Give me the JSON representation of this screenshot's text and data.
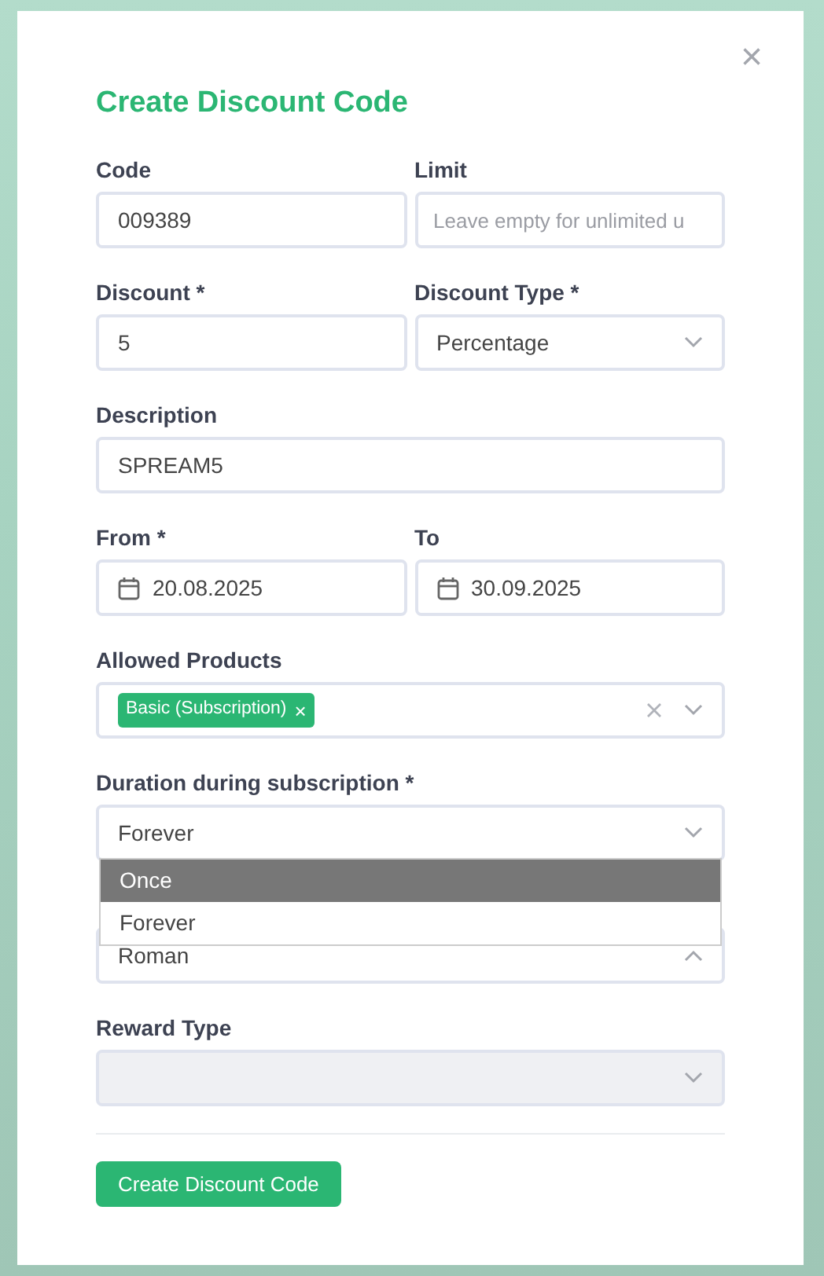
{
  "dialog": {
    "title": "Create Discount Code",
    "close": "×"
  },
  "rows": [
    [
      {
        "kind": "text",
        "label": "Code",
        "value": "009389"
      },
      {
        "kind": "text",
        "label": "Limit",
        "placeholder": "Leave empty for unlimited u"
      }
    ],
    [
      {
        "kind": "text",
        "label": "Discount *",
        "value": "5"
      },
      {
        "kind": "select",
        "label": "Discount Type *",
        "value": "Percentage",
        "expanded": false,
        "disabled": false
      }
    ],
    [
      {
        "kind": "text",
        "label": "Description",
        "value": "SPREAM5"
      }
    ],
    [
      {
        "kind": "date",
        "label": "From *",
        "value": "20.08.2025"
      },
      {
        "kind": "date",
        "label": "To",
        "value": "30.09.2025"
      }
    ],
    [
      {
        "kind": "multi",
        "label": "Allowed Products",
        "tags": [
          {
            "text": "Basic (Subscription)",
            "remove": "×"
          }
        ]
      }
    ],
    [
      {
        "kind": "select",
        "label": "Duration during subscription *",
        "value": "Forever",
        "expanded": false,
        "disabled": false,
        "menu": [
          {
            "text": "Once",
            "highlighted": true
          },
          {
            "text": "Forever",
            "highlighted": false
          }
        ]
      }
    ],
    [
      {
        "kind": "select",
        "value": "Roman",
        "expanded": true,
        "disabled": false
      }
    ],
    [
      {
        "kind": "select",
        "label": "Reward Type",
        "expanded": false,
        "disabled": true
      }
    ]
  ],
  "submit": "Create Discount Code"
}
